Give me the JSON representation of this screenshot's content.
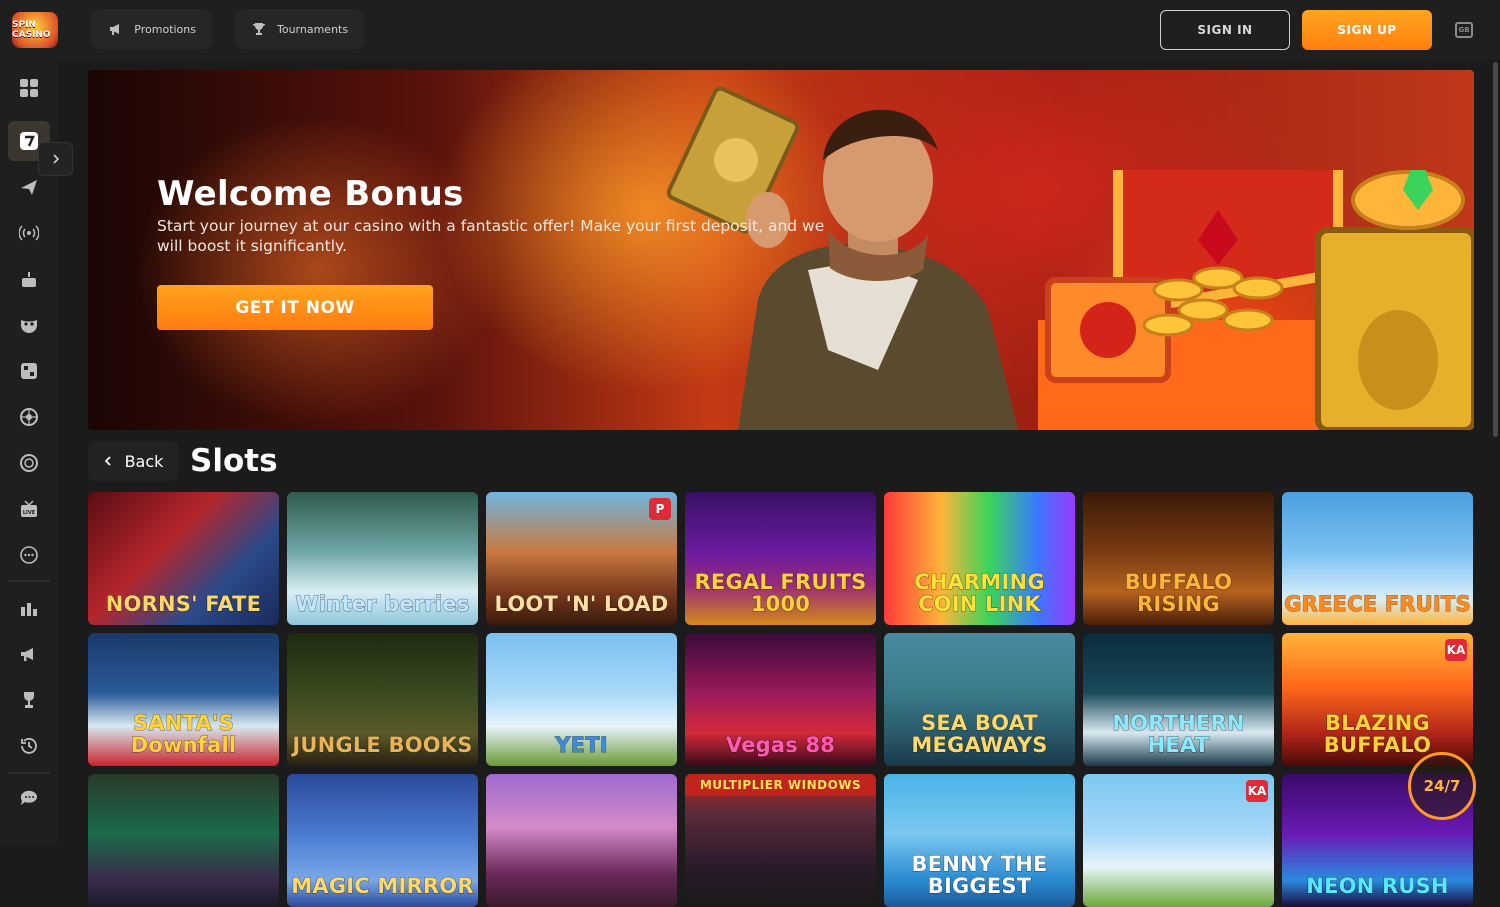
{
  "header": {
    "logo_text": "SPIN CASINO",
    "nav": [
      {
        "label": "Promotions",
        "icon": "megaphone-icon"
      },
      {
        "label": "Tournaments",
        "icon": "trophy-icon"
      }
    ],
    "sign_in": "SIGN IN",
    "sign_up": "SIGN UP",
    "language": "GB"
  },
  "sidebar": {
    "items": [
      {
        "name": "all-games",
        "icon": "grid-icon"
      },
      {
        "name": "slots",
        "icon": "seven-icon",
        "active": true
      },
      {
        "name": "crash",
        "icon": "plane-icon"
      },
      {
        "name": "live",
        "icon": "broadcast-icon"
      },
      {
        "name": "bonus-buy",
        "icon": "cake-icon"
      },
      {
        "name": "table",
        "icon": "mask-icon"
      },
      {
        "name": "instant",
        "icon": "dice-icon"
      },
      {
        "name": "roulette",
        "icon": "roulette-icon"
      },
      {
        "name": "jackpot",
        "icon": "chip-icon"
      },
      {
        "name": "live-casino",
        "icon": "live-tv-icon"
      },
      {
        "name": "other",
        "icon": "dots-icon"
      },
      {
        "name": "leaderboard",
        "icon": "stats-icon"
      },
      {
        "name": "promotions",
        "icon": "megaphone-icon"
      },
      {
        "name": "tournaments",
        "icon": "trophy-icon"
      },
      {
        "name": "history",
        "icon": "history-icon"
      },
      {
        "name": "chat",
        "icon": "chat-icon"
      }
    ]
  },
  "banner": {
    "title": "Welcome Bonus",
    "text": "Start your journey at our casino with a fantastic offer! Make your first deposit, and we will boost it significantly.",
    "cta": "GET IT NOW"
  },
  "section": {
    "back_label": "Back",
    "title": "Slots"
  },
  "games": [
    {
      "name": "NORNS' FATE",
      "bg": "linear-gradient(135deg,#5a0c14,#b4262c 40%,#2a4a8a 70%,#1a2a5a)",
      "color": "#ffd86a"
    },
    {
      "name": "Winter berries",
      "bg": "linear-gradient(180deg,#2f5a4e,#6fa7a5 45%,#d8eef5 75%,#8fc7da)",
      "color": "#bfe6ff"
    },
    {
      "name": "LOOT 'N' LOAD",
      "bg": "linear-gradient(180deg,#6fb6e0,#c9793f 45%,#7a3a1e 75%,#3a1a0c)",
      "color": "#ffe0a8",
      "badge": "P"
    },
    {
      "name": "REGAL FRUITS 1000",
      "bg": "linear-gradient(180deg,#3a1064,#6a1ba0 45%,#9a2a7a 70%,#d48a1a)",
      "color": "#ffd23a"
    },
    {
      "name": "CHARMING COIN LINK",
      "bg": "linear-gradient(90deg,#ff3a3a,#ffb43a 30%,#3ad45a 55%,#3a7aff 80%,#9a3aff)",
      "color": "#ffe03a"
    },
    {
      "name": "BUFFALO RISING",
      "bg": "linear-gradient(180deg,#3a1a08,#7a3a12 45%,#b4621e 75%,#4a1e08)",
      "color": "#ffb43a"
    },
    {
      "name": "GREECE FRUITS",
      "bg": "linear-gradient(180deg,#4aa0e0,#7ac0f0 45%,#d8eefa 80%,#ffb43a)",
      "color": "#ff8a1a"
    },
    {
      "name": "SANTA'S Downfall",
      "bg": "linear-gradient(180deg,#1a3a6a,#2a5a9a 45%,#d8e8f0 70%,#c8242c)",
      "color": "#ffd23a"
    },
    {
      "name": "JUNGLE BOOKS",
      "bg": "linear-gradient(180deg,#1e2a12,#3a4a1e 45%,#5a5a2a 75%,#2a2012)",
      "color": "#e8b45a"
    },
    {
      "name": "YETI",
      "bg": "linear-gradient(180deg,#7ac0f0,#a8d8f8 45%,#e8f4fa 70%,#6a9a3a)",
      "color": "#3a8ae0"
    },
    {
      "name": "Vegas 88",
      "bg": "linear-gradient(180deg,#3a0a3a,#9a1a5a 45%,#d42a3a 75%,#3a0a1a)",
      "color": "#ff5ab4"
    },
    {
      "name": "SEA BOAT MEGAWAYS",
      "bg": "linear-gradient(180deg,#4a8aa0,#3a7a8a 45%,#2a5a6a 75%,#1a3a4a)",
      "color": "#ffd86a"
    },
    {
      "name": "NORTHERN HEAT",
      "bg": "linear-gradient(180deg,#0a2a3a,#1a4a5a 45%,#d8e8f0 75%,#1a3a4a)",
      "color": "#8ae8ff"
    },
    {
      "name": "BLAZING BUFFALO",
      "bg": "linear-gradient(180deg,#ffb43a,#ff6a1a 40%,#b4261a 75%,#4a0a08)",
      "color": "#ffd23a",
      "badge": "KA"
    },
    {
      "name": "",
      "bg": "linear-gradient(180deg,#2a3a2a,#1a6a4a 45%,#3a2a4a 80%,#1a1a2a)",
      "color": "#fff"
    },
    {
      "name": "MAGIC MIRROR",
      "bg": "linear-gradient(180deg,#2a4a9a,#4a7ad0 45%,#7aa8e8 80%,#2a4a9a)",
      "color": "#ffd86a"
    },
    {
      "name": "",
      "bg": "linear-gradient(180deg,#a06ad0,#d48ac8 40%,#6a2a5a 75%,#3a1a2a)",
      "color": "#fff"
    },
    {
      "name": "",
      "bg": "linear-gradient(180deg,#c0241c,#5a2a3a 30%,#2a1a2a 70%,#1a1a1a)",
      "color": "#fff",
      "topbanner": "MULTIPLIER WINDOWS"
    },
    {
      "name": "BENNY THE BIGGEST",
      "bg": "linear-gradient(180deg,#4ab4e8,#7ac8f0 45%,#2a8ad0 80%,#1a5a9a)",
      "color": "#fff"
    },
    {
      "name": "",
      "bg": "linear-gradient(180deg,#7ac8f0,#a8d8f8 45%,#e8f4fa 70%,#6aa83a)",
      "color": "#fff",
      "badge": "KA"
    },
    {
      "name": "NEON RUSH",
      "bg": "linear-gradient(180deg,#3a0a6a,#6a1ab4 45%,#2a8ae0 80%,#1a0a3a)",
      "color": "#5ae8ff"
    }
  ],
  "support": {
    "label": "24/7"
  },
  "colors": {
    "accent": "#ff8f17",
    "bg": "#1b1b1b",
    "panel": "#1f1f1f"
  }
}
